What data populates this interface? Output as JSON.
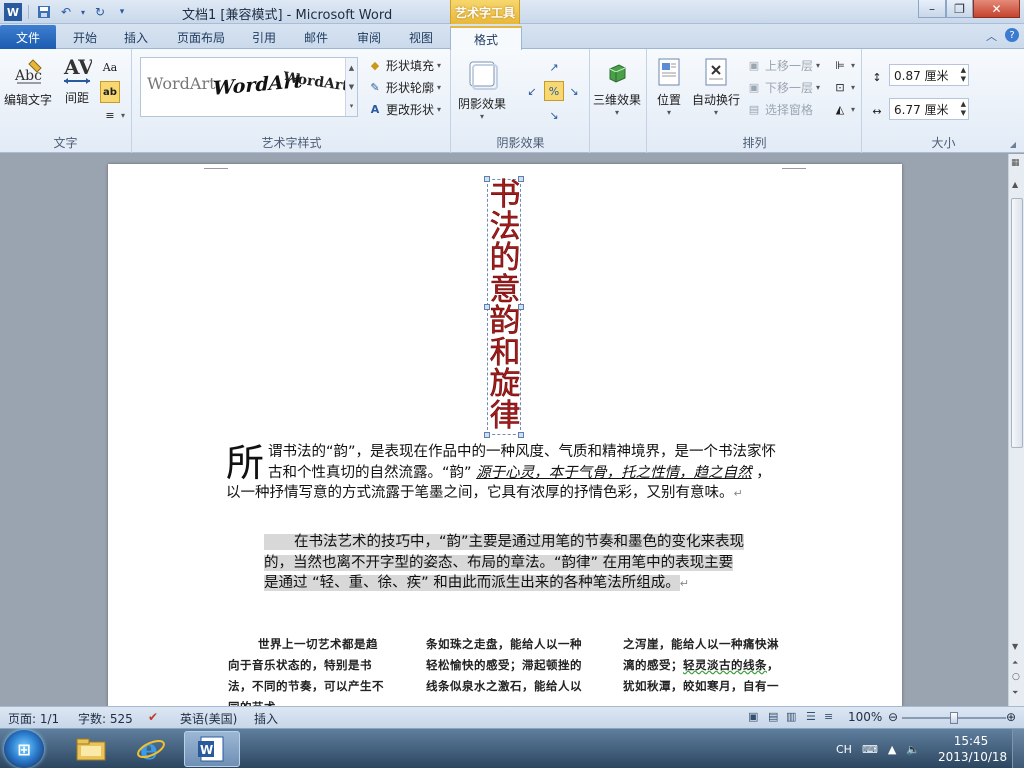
{
  "title_bar": {
    "title": "文档1 [兼容模式] - Microsoft Word",
    "context_tab_group": "艺术字工具"
  },
  "tabs": [
    {
      "label": "文件",
      "active": false
    },
    {
      "label": "开始",
      "active": false
    },
    {
      "label": "插入",
      "active": false
    },
    {
      "label": "页面布局",
      "active": false
    },
    {
      "label": "引用",
      "active": false
    },
    {
      "label": "邮件",
      "active": false
    },
    {
      "label": "审阅",
      "active": false
    },
    {
      "label": "视图",
      "active": false
    },
    {
      "label": "格式",
      "active": true
    }
  ],
  "ribbon": {
    "text_group": {
      "label": "文字",
      "edit_text": "编辑文字",
      "spacing": "间距"
    },
    "wordart_styles": {
      "label": "艺术字样式",
      "samples": [
        "WordArt",
        "WordArt",
        "WordArt"
      ],
      "shape_fill": "形状填充",
      "shape_outline": "形状轮廓",
      "change_shape": "更改形状"
    },
    "shadow": {
      "label": "阴影效果",
      "shadow_effects": "阴影效果"
    },
    "three_d": {
      "label": "三维效果",
      "button": "三维效果"
    },
    "arrange": {
      "label": "排列",
      "position": "位置",
      "wrap_text": "自动换行",
      "bring_forward": "上移一层",
      "send_backward": "下移一层",
      "selection_pane": "选择窗格"
    },
    "size": {
      "label": "大小",
      "height": "0.87 厘米",
      "width": "6.77 厘米"
    }
  },
  "document": {
    "wordart_text": "书法的意韵和旋律",
    "p1_dropcap": "所",
    "p1_text_a": "谓书法的“韵”，是表现在作品中的一种风度、气质和精神境界，是一个书法家怀古和个性真切的自然流露。“韵”",
    "p1_italic": "源于心灵，本于气骨，托之性情，趋之自然",
    "p1_text_b": "，以一种抒情写意的方式流露于笔墨之间，它具有浓厚的抒情色彩，又别有意味。",
    "p2_text": "在书法艺术的技巧中，“韵”主要是通过用笔的节奏和墨色的变化来表现的，当然也离不开字型的姿态、布局的章法。“韵律” 在用笔中的表现主要是通过 “轻、重、徐、疾” 和由此而派生出来的各种笔法所组成。",
    "col1": "世界上一切艺术都是趋向于音乐状态的，特别是书法，不同的节奏，可以产生不同的艺术",
    "col2": "条如珠之走盘，能给人以一种轻松愉快的感受；滞起顿挫的线条似泉水之激石，能给人以",
    "col3_a": "之泻崖，能给人以一种痛快淋漓的感受；",
    "col3_b": "轻灵淡古的线条",
    "col3_c": "，犹如秋潭，皎如寒月，自有一"
  },
  "status_bar": {
    "page": "页面: 1/1",
    "words": "字数: 525",
    "language": "英语(美国)",
    "mode": "插入",
    "zoom": "100%",
    "zoom_level": 1.0
  },
  "taskbar": {
    "ime": "CH",
    "time": "15:45",
    "date": "2013/10/18"
  },
  "colors": {
    "wordart_red": "#a11c1c",
    "file_tab_blue": "#2a6bc4",
    "context_gold": "#e8b73a"
  }
}
